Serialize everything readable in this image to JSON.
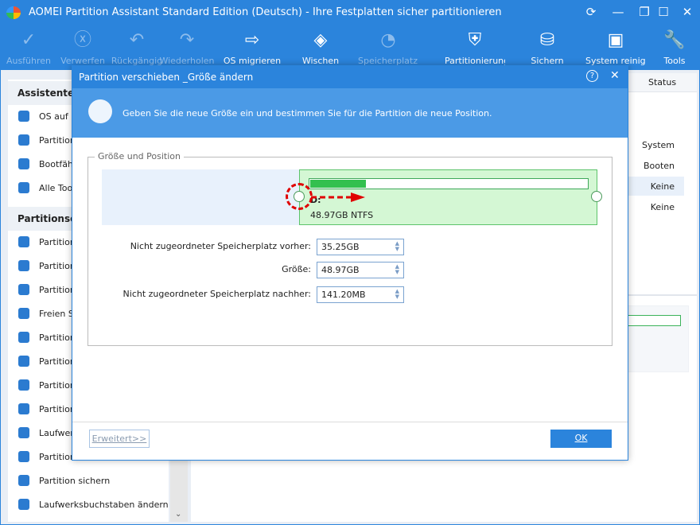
{
  "window": {
    "title": "AOMEI Partition Assistant Standard Edition (Deutsch) - Ihre Festplatten sicher partitionieren"
  },
  "toolbar": [
    {
      "label": "Ausführen",
      "icon": "check-icon",
      "enabled": false
    },
    {
      "label": "Verwerfen",
      "icon": "discard-icon",
      "enabled": false
    },
    {
      "label": "Rückgängig",
      "icon": "undo-icon",
      "enabled": false
    },
    {
      "label": "Wiederholen",
      "icon": "redo-icon",
      "enabled": false
    },
    {
      "label": "OS migrieren",
      "icon": "migrate-os-icon",
      "enabled": true
    },
    {
      "label": "Wischen",
      "icon": "wipe-icon",
      "enabled": true
    },
    {
      "label": "Speicherplatz ver",
      "icon": "space-analyzer-icon",
      "enabled": false
    },
    {
      "label": "Partitionierung",
      "icon": "shield-icon",
      "enabled": true
    },
    {
      "label": "Sichern",
      "icon": "backup-icon",
      "enabled": true
    },
    {
      "label": "System reinigen",
      "icon": "clean-system-icon",
      "enabled": true
    },
    {
      "label": "Tools",
      "icon": "tools-icon",
      "enabled": true
    }
  ],
  "sidebar": {
    "wizards_title": "Assistenten",
    "wizards": [
      "OS auf S",
      "Partition",
      "Bootfähi",
      "Alle Tool"
    ],
    "ops_title": "Partitionsop",
    "ops": [
      "Partition",
      "Partition",
      "Partition",
      "Freien Sp",
      "Partition",
      "Partition",
      "Partition",
      "Partition",
      "Laufwerk",
      "Partition",
      "Partition sichern",
      "Laufwerksbuchstaben ändern"
    ]
  },
  "table": {
    "status_header": "Status",
    "status": [
      "System",
      "Booten",
      "Keine",
      "Keine"
    ]
  },
  "dialog": {
    "title": "Partition verschieben _Größe ändern",
    "instruction": "Geben Sie die neue Größe ein und bestimmen Sie für die Partition die neue Position.",
    "group_label": "Größe und Position",
    "partition": {
      "letter": "D:",
      "info": "48.97GB NTFS",
      "used_fraction": 0.2
    },
    "fields": [
      {
        "label": "Nicht zugeordneter Speicherplatz vorher:",
        "value": "35.25GB"
      },
      {
        "label": "Größe:",
        "value": "48.97GB"
      },
      {
        "label": "Nicht zugeordneter Speicherplatz nachher:",
        "value": "141.20MB"
      }
    ],
    "advanced_label": "Erweitert>>",
    "ok_label": "OK"
  },
  "colors": {
    "accent": "#2b84dc",
    "partition_fill": "#d4f7d4",
    "used_bar": "#33c04f",
    "arrow": "#e00000"
  }
}
